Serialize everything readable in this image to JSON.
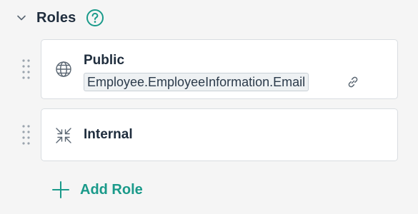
{
  "section": {
    "title": "Roles",
    "accent_color": "#1a9a8a"
  },
  "roles": [
    {
      "name": "Public",
      "icon": "globe-icon",
      "tag": "Employee.EmployeeInformation.Email",
      "has_link": true
    },
    {
      "name": "Internal",
      "icon": "collapse-arrows-icon"
    }
  ],
  "add_role": {
    "label": "Add Role"
  }
}
